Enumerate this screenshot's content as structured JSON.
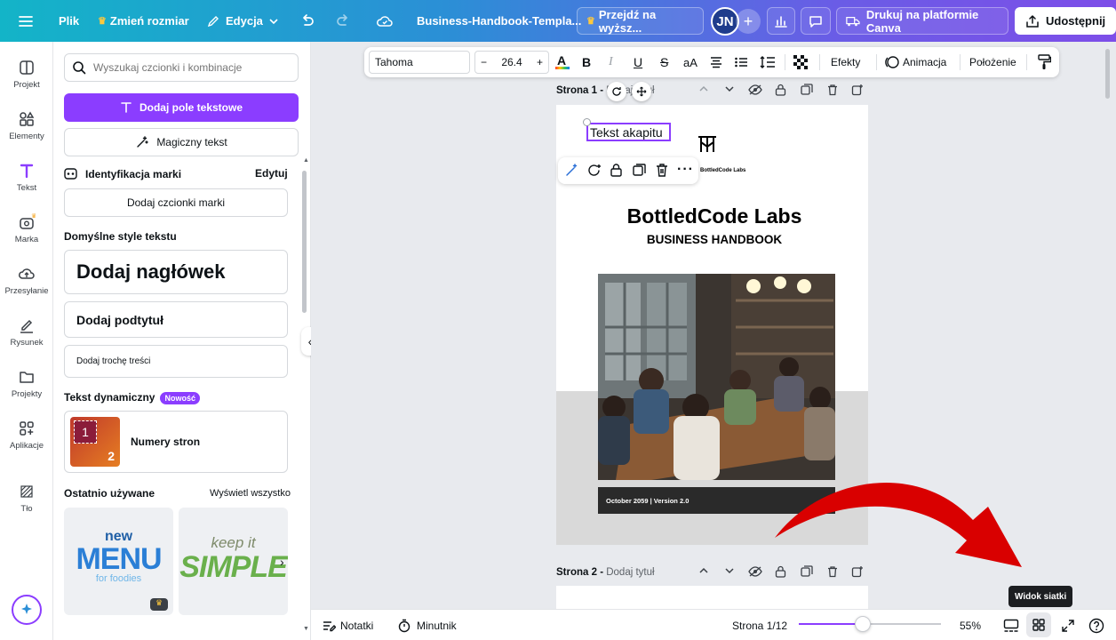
{
  "topbar": {
    "menu_icon": "hamburger-icon",
    "file": "Plik",
    "resize": "Zmień rozmiar",
    "edit": "Edycja",
    "doc_title": "Business-Handbook-Templa...",
    "upgrade": "Przejdź na wyższ...",
    "avatar_initials": "JN",
    "print": "Drukuj na platformie Canva",
    "share": "Udostępnij"
  },
  "rail": {
    "items": [
      {
        "label": "Projekt",
        "icon": "layout-icon"
      },
      {
        "label": "Elementy",
        "icon": "shapes-icon"
      },
      {
        "label": "Tekst",
        "icon": "text-icon"
      },
      {
        "label": "Marka",
        "icon": "brand-icon"
      },
      {
        "label": "Przesyłanie",
        "icon": "upload-icon"
      },
      {
        "label": "Rysunek",
        "icon": "draw-icon"
      },
      {
        "label": "Projekty",
        "icon": "folder-icon"
      },
      {
        "label": "Aplikacje",
        "icon": "apps-icon"
      },
      {
        "label": "Tło",
        "icon": "background-icon"
      }
    ]
  },
  "panel": {
    "search_placeholder": "Wyszukaj czcionki i kombinacje",
    "add_textbox": "Dodaj pole tekstowe",
    "magic_text": "Magiczny tekst",
    "brand_section": "Identyfikacja marki",
    "brand_edit": "Edytuj",
    "add_brand_fonts": "Dodaj czcionki marki",
    "default_styles": "Domyślne style tekstu",
    "heading": "Dodaj nagłówek",
    "subheading": "Dodaj podtytuł",
    "body": "Dodaj trochę treści",
    "dynamic_text": "Tekst dynamiczny",
    "new_badge": "Nowość",
    "page_numbers": "Numery stron",
    "recent": "Ostatnio używane",
    "show_all": "Wyświetl wszystko",
    "recent_items": [
      {
        "line1": "new",
        "line2": "MENU",
        "line3": "for foodies"
      },
      {
        "line1": "keep it",
        "line2": "SIMPLE"
      }
    ],
    "thumb_numbers": [
      "1",
      "2"
    ]
  },
  "toolbar": {
    "font": "Tahoma",
    "size": "26.4",
    "minus": "−",
    "plus": "+",
    "bold": "B",
    "italic": "I",
    "underline": "U",
    "strike": "S",
    "case": "aA",
    "effects": "Efekty",
    "animate": "Animacja",
    "position": "Położenie"
  },
  "canvas": {
    "page1_label": "Strona 1 - ",
    "page1_sub": "Dodaj tytuł",
    "page2_label": "Strona 2 - ",
    "page2_sub": "Dodaj tytuł",
    "selected_text": "Tekst akapitu",
    "logo_text": "BottledCode Labs",
    "title": "BottledCode Labs",
    "subtitle": "BUSINESS HANDBOOK",
    "footer": "October 2059 | Version 2.0"
  },
  "bottombar": {
    "notes": "Notatki",
    "timer": "Minutnik",
    "page": "Strona 1/12",
    "zoom": "55%",
    "zoom_fraction": 0.45,
    "tooltip": "Widok siatki"
  },
  "colors": {
    "accent": "#8b3dff",
    "arrow": "#e00000"
  }
}
